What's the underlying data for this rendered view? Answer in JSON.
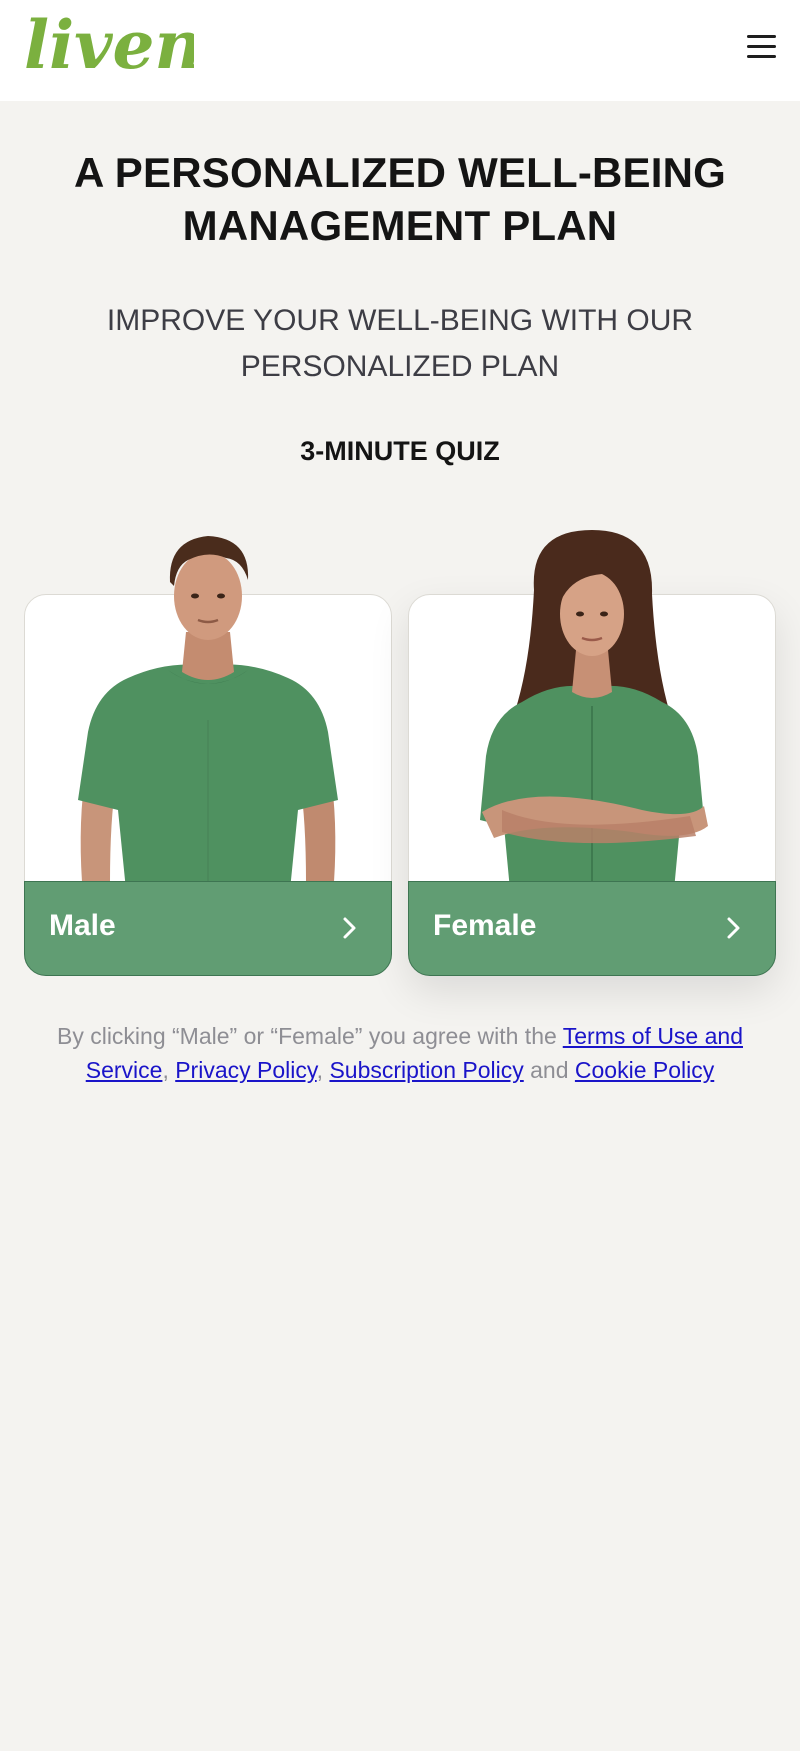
{
  "header": {
    "logo_text": "liven",
    "menu_icon": "hamburger-menu-icon"
  },
  "hero": {
    "title_line1": "A PERSONALIZED WELL-BEING",
    "title_line2": "MANAGEMENT PLAN",
    "subtitle_line1": "IMPROVE YOUR WELL-BEING WITH OUR",
    "subtitle_line2": "PERSONALIZED PLAN",
    "quiz_label": "3-MINUTE QUIZ"
  },
  "options": [
    {
      "label": "Male",
      "icon": "chevron-right-icon"
    },
    {
      "label": "Female",
      "icon": "chevron-right-icon"
    }
  ],
  "legal": {
    "prefix": "By clicking “Male” or “Female” you agree with the ",
    "terms": "Terms of Use and Service",
    "comma1": ", ",
    "privacy": "Privacy Policy",
    "comma2": ", ",
    "subscription": "Subscription Policy",
    "and": " and ",
    "cookie": "Cookie Policy"
  },
  "colors": {
    "brand_green": "#7bb03f",
    "button_green": "#619d73",
    "link": "#1a14c9",
    "background": "#f4f3f0"
  }
}
